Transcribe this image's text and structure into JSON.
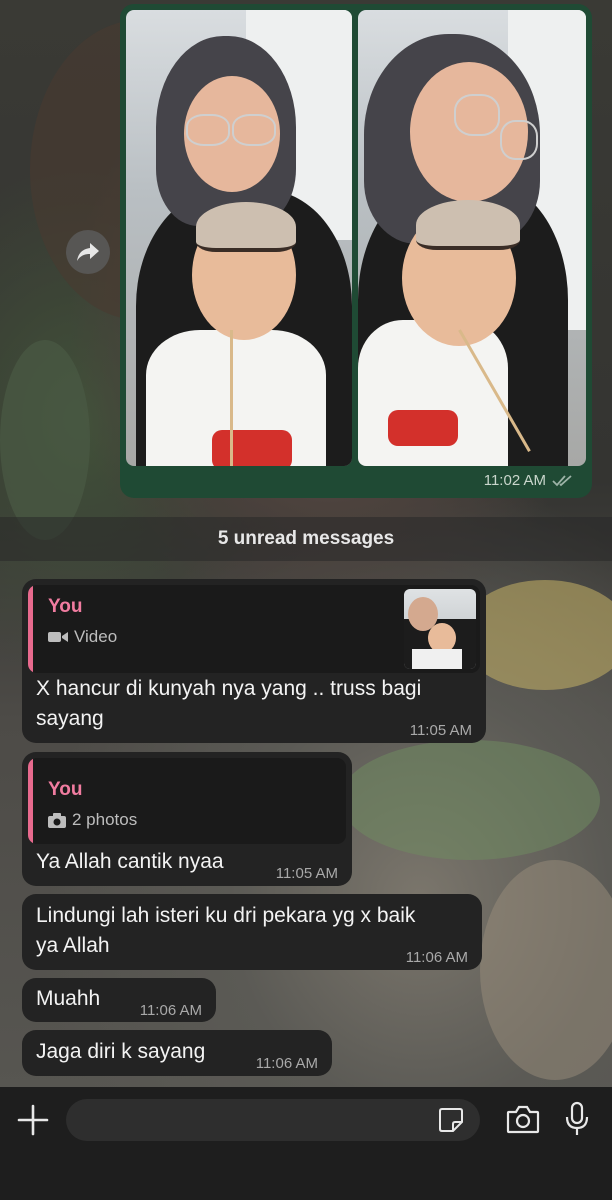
{
  "album": {
    "time": "11:02 AM",
    "status": "read"
  },
  "unread_banner": "5 unread messages",
  "messages": [
    {
      "reply": {
        "author": "You",
        "media_label": "Video",
        "media_icon": "video-icon"
      },
      "text_line1": "X hancur di kunyah nya yang .. truss bagi",
      "text_line2": "sayang",
      "time": "11:05 AM"
    },
    {
      "reply": {
        "author": "You",
        "media_label": "2 photos",
        "media_icon": "camera-icon"
      },
      "text_line1": "Ya Allah cantik nyaa",
      "time": "11:05 AM"
    },
    {
      "text_line1": "Lindungi lah isteri ku dri pekara yg x baik",
      "text_line2": "ya Allah",
      "time": "11:06 AM"
    },
    {
      "text_line1": "Muahh",
      "time": "11:06 AM"
    },
    {
      "text_line1": "Jaga diri k sayang",
      "time": "11:06 AM"
    }
  ],
  "input": {
    "value": "",
    "placeholder": ""
  },
  "colors": {
    "sent_bubble": "#1f4a34",
    "received_bubble": "#232323",
    "reply_accent": "#e86a8e",
    "read_ticks": "#9db3a7"
  }
}
